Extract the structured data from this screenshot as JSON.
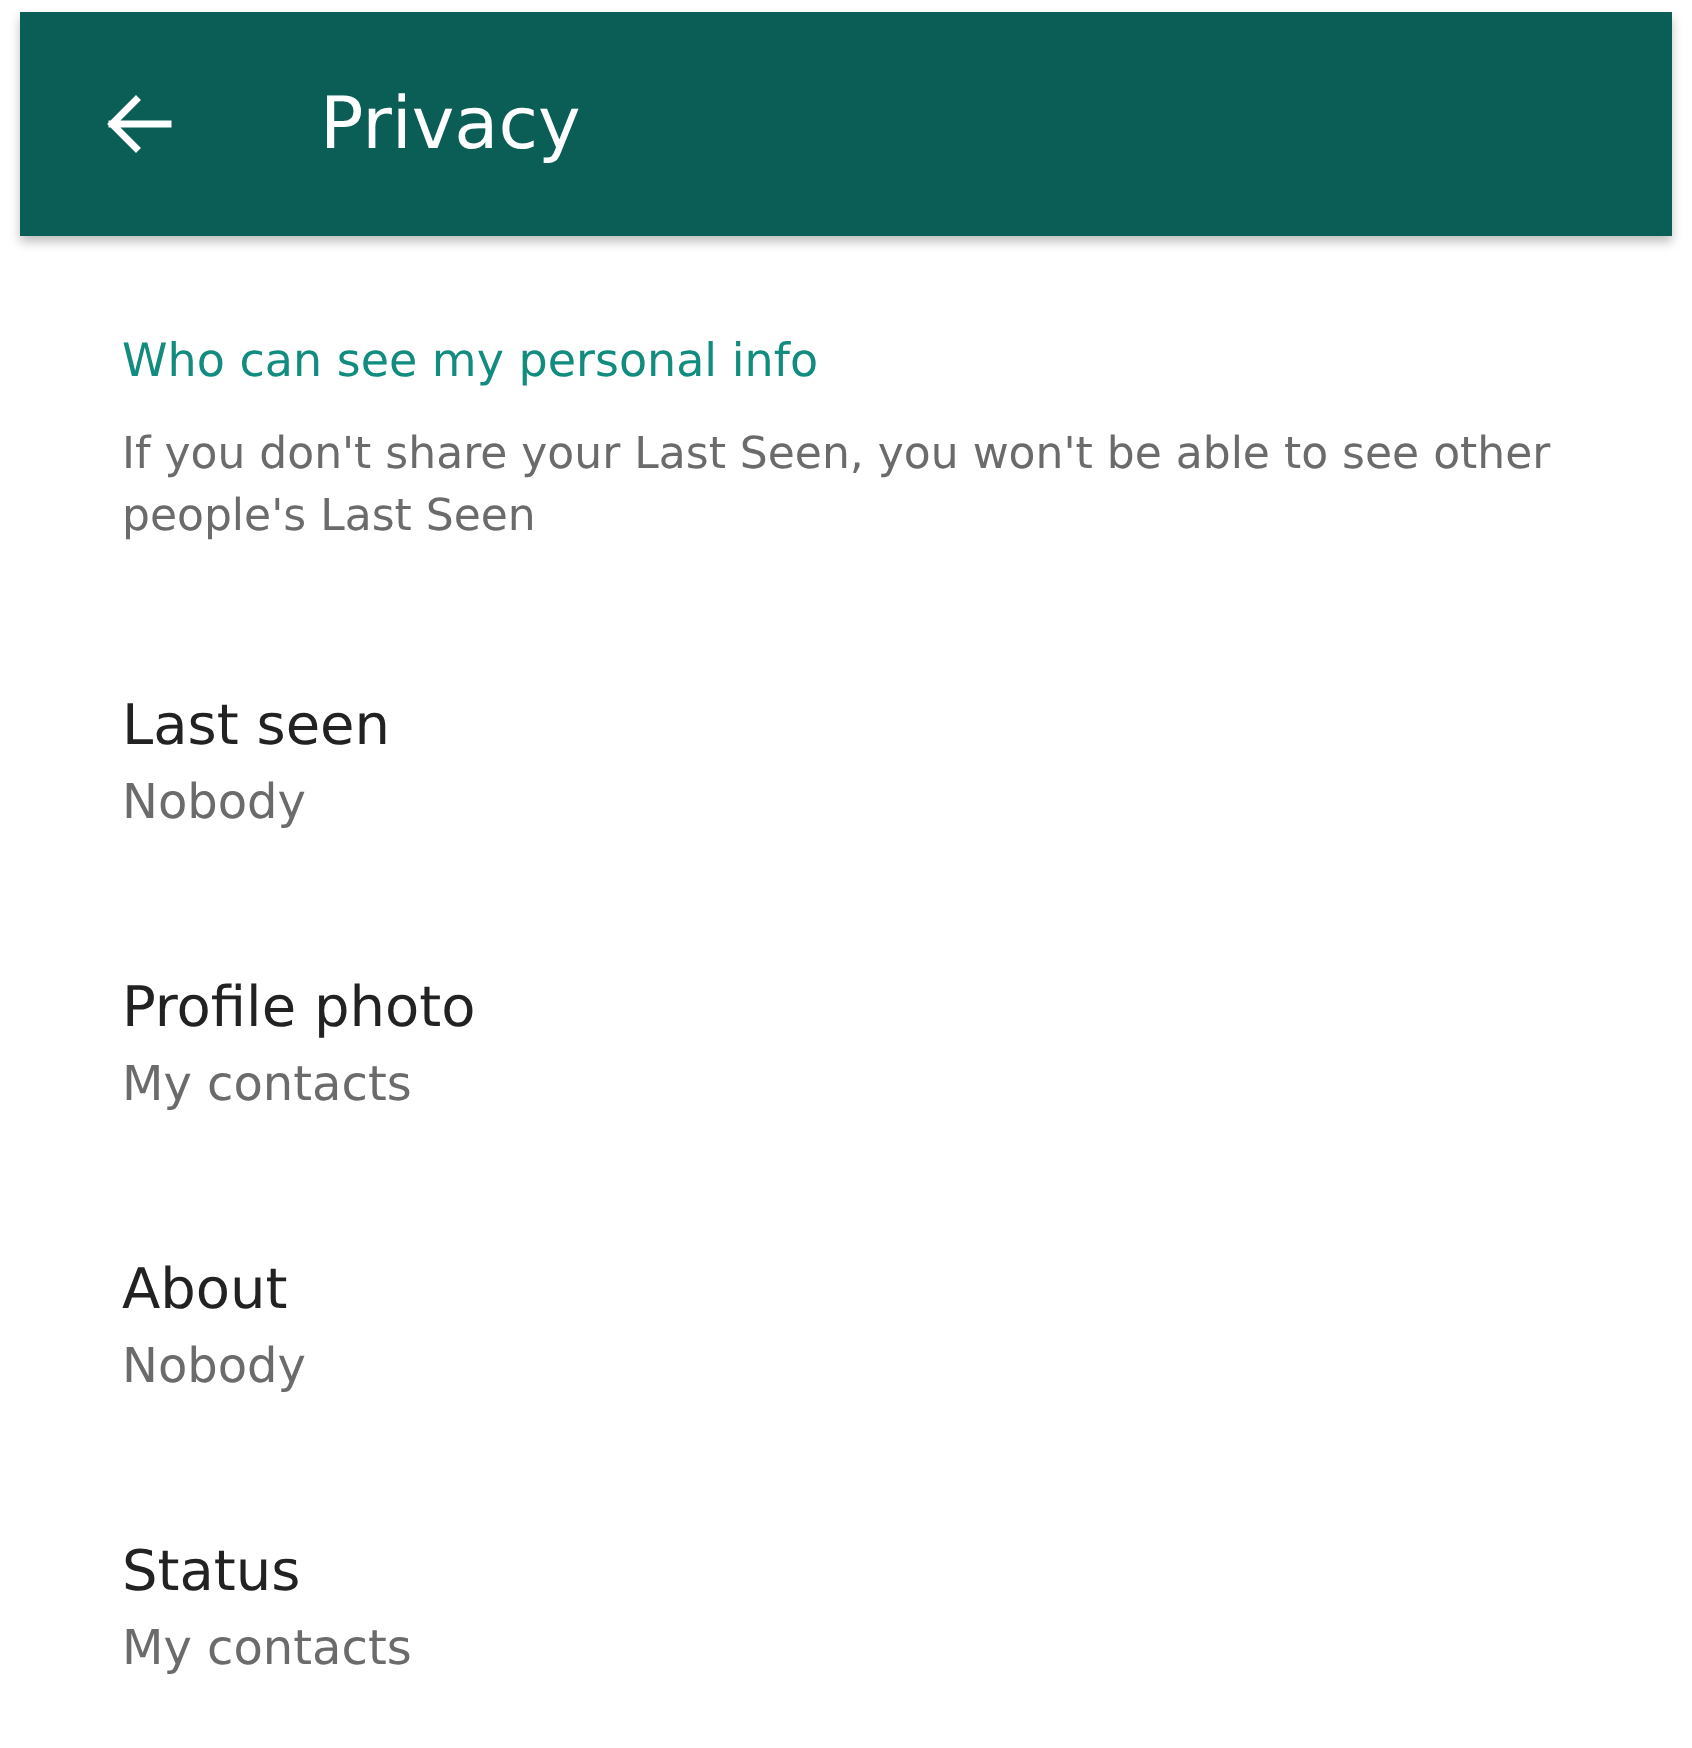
{
  "app_bar": {
    "title": "Privacy"
  },
  "section": {
    "heading": "Who can see my personal info",
    "description": "If you don't share your Last Seen, you won't be able to see other people's Last Seen"
  },
  "settings": [
    {
      "label": "Last seen",
      "value": "Nobody"
    },
    {
      "label": "Profile photo",
      "value": "My contacts"
    },
    {
      "label": "About",
      "value": "Nobody"
    },
    {
      "label": "Status",
      "value": "My contacts"
    }
  ]
}
